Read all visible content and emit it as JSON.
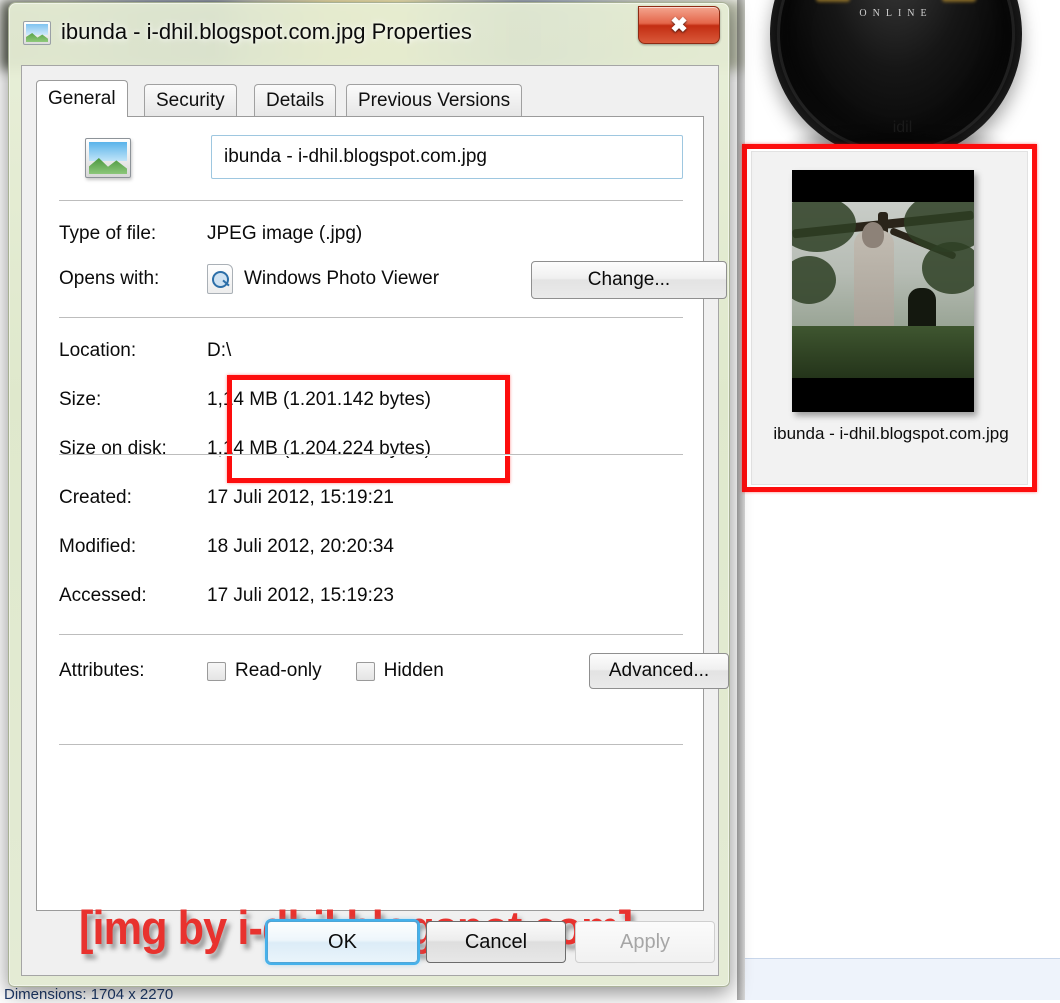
{
  "window": {
    "title": "ibunda - i-dhil.blogspot.com.jpg Properties",
    "icon": "picture-file-icon",
    "close_glyph": "✖"
  },
  "tabs": [
    {
      "label": "General",
      "active": true
    },
    {
      "label": "Security",
      "active": false
    },
    {
      "label": "Details",
      "active": false
    },
    {
      "label": "Previous Versions",
      "active": false
    }
  ],
  "general": {
    "filename_value": "ibunda - i-dhil.blogspot.com.jpg",
    "rows": [
      {
        "label": "Type of file:",
        "value": "JPEG image (.jpg)"
      },
      {
        "label": "Opens with:",
        "value": "Windows Photo Viewer"
      },
      {
        "label": "Location:",
        "value": "D:\\"
      },
      {
        "label": "Size:",
        "value": "1,14 MB (1.201.142 bytes)"
      },
      {
        "label": "Size on disk:",
        "value": "1,14 MB (1.204.224 bytes)"
      },
      {
        "label": "Created:",
        "value": "17 Juli 2012, 15:19:21"
      },
      {
        "label": "Modified:",
        "value": "18 Juli 2012, 20:20:34"
      },
      {
        "label": "Accessed:",
        "value": "17 Juli 2012, 15:19:23"
      },
      {
        "label": "Attributes:",
        "value": ""
      }
    ],
    "change_button": "Change...",
    "advanced_button": "Advanced...",
    "attributes": [
      {
        "label": "Read-only",
        "checked": false
      },
      {
        "label": "Hidden",
        "checked": false
      }
    ]
  },
  "footer": {
    "ok": "OK",
    "cancel": "Cancel",
    "apply": "Apply"
  },
  "watermark": "[img by i-dhil.blogspot.com]",
  "explorer": {
    "idil_label": "idil",
    "idil_disc_text": "ONLINE",
    "selected_file_label": "ibunda -\ni-dhil.blogspot.com.jpg",
    "status_text": "Dimensions: 1704 x 2270"
  },
  "colors": {
    "annotation_red": "#fd0d0d",
    "focus_blue": "#45b1eb",
    "close_red": "#c32d12",
    "glass_green": "#e2ead2"
  }
}
